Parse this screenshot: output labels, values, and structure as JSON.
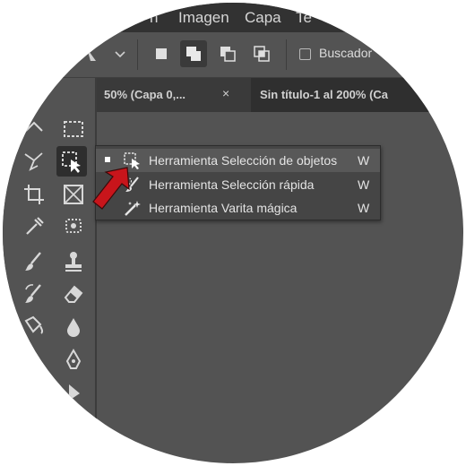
{
  "menu": {
    "items": [
      {
        "label": "n"
      },
      {
        "label": "Imagen"
      },
      {
        "label": "Capa"
      },
      {
        "label": "Te"
      }
    ]
  },
  "options": {
    "finder_label": "Buscador"
  },
  "tabs": [
    {
      "label": "50% (Capa 0,...",
      "close": "×"
    },
    {
      "label": "Sin título-1 al 200% (Ca",
      "close": ""
    }
  ],
  "flyout": {
    "items": [
      {
        "label": "Herramienta Selección de objetos",
        "key": "W",
        "icon": "object-selection-icon",
        "active": true
      },
      {
        "label": "Herramienta Selección rápida",
        "key": "W",
        "icon": "quick-selection-icon",
        "active": false
      },
      {
        "label": "Herramienta Varita mágica",
        "key": "W",
        "icon": "magic-wand-icon",
        "active": false
      }
    ]
  },
  "colors": {
    "app_bg": "#535353",
    "menubar": "#323232",
    "pointer": "#c8151b"
  }
}
